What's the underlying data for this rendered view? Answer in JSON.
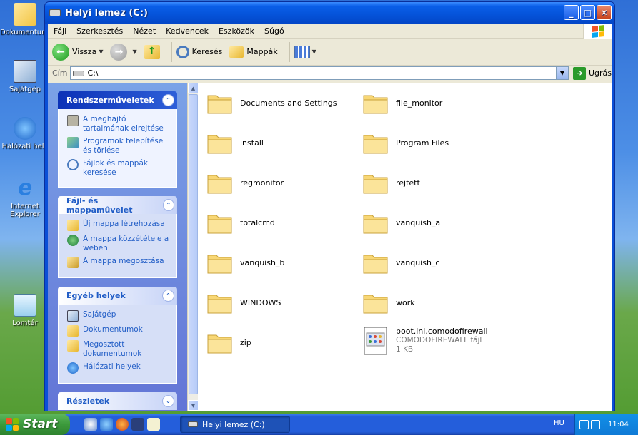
{
  "desktop": {
    "icons": [
      {
        "label": "Dokumentumo",
        "top": 0
      },
      {
        "label": "Sajátgép"
      },
      {
        "label": "Hálózati hely"
      },
      {
        "label": "Internet Explorer"
      },
      {
        "label": "Lomtár"
      }
    ]
  },
  "window": {
    "title": "Helyi lemez (C:)",
    "buttons": {
      "minimize": "_",
      "maximize": "□",
      "close": "✕"
    }
  },
  "menubar": [
    "Fájl",
    "Szerkesztés",
    "Nézet",
    "Kedvencek",
    "Eszközök",
    "Súgó"
  ],
  "toolbar": {
    "back": "Vissza",
    "search": "Keresés",
    "folders": "Mappák"
  },
  "addressbar": {
    "label": "Cím",
    "value": "C:\\",
    "go": "Ugrás"
  },
  "taskpane": {
    "system_tasks": {
      "title": "Rendszerműveletek",
      "items": [
        "A meghajtó tartalmának elrejtése",
        "Programok telepítése és törlése",
        "Fájlok és mappák keresése"
      ]
    },
    "file_tasks": {
      "title": "Fájl- és mappaművelet",
      "items": [
        "Új mappa létrehozása",
        "A mappa közzététele a weben",
        "A mappa megosztása"
      ]
    },
    "other_places": {
      "title": "Egyéb helyek",
      "items": [
        "Sajátgép",
        "Dokumentumok",
        "Megosztott dokumentumok",
        "Hálózati helyek"
      ]
    },
    "details": {
      "title": "Részletek"
    }
  },
  "files": [
    {
      "name": "Documents and Settings",
      "type": "folder"
    },
    {
      "name": "file_monitor",
      "type": "folder"
    },
    {
      "name": "install",
      "type": "folder"
    },
    {
      "name": "Program Files",
      "type": "folder"
    },
    {
      "name": "regmonitor",
      "type": "folder"
    },
    {
      "name": "rejtett",
      "type": "folder"
    },
    {
      "name": "totalcmd",
      "type": "folder"
    },
    {
      "name": "vanquish_a",
      "type": "folder"
    },
    {
      "name": "vanquish_b",
      "type": "folder"
    },
    {
      "name": "vanquish_c",
      "type": "folder"
    },
    {
      "name": "WINDOWS",
      "type": "folder"
    },
    {
      "name": "work",
      "type": "folder"
    },
    {
      "name": "zip",
      "type": "folder"
    },
    {
      "name": "boot.ini.comodofirewall",
      "type": "file",
      "filetype": "COMODOFIREWALL fájl",
      "size": "1 KB"
    }
  ],
  "taskbar": {
    "start": "Start",
    "task": "Helyi lemez (C:)",
    "lang": "HU",
    "clock": "11:04"
  }
}
